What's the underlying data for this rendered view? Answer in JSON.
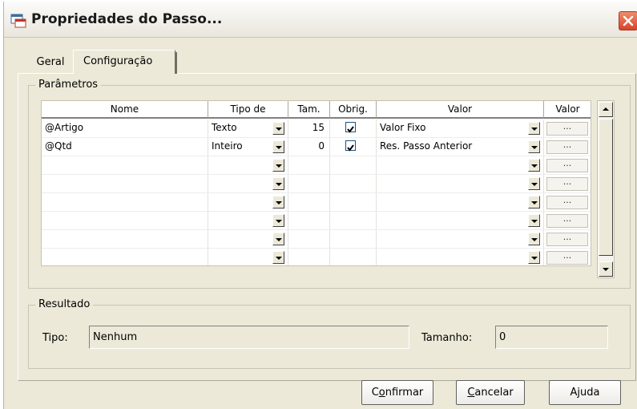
{
  "window": {
    "title": "Propriedades do Passo..."
  },
  "tabs": [
    {
      "label": "Geral",
      "active": false
    },
    {
      "label": "Configuração",
      "active": true
    }
  ],
  "parametros": {
    "legend": "Parâmetros",
    "columns": {
      "nome": "Nome",
      "tipo": "Tipo de",
      "tam": "Tam.",
      "obrig": "Obrig.",
      "valor": "Valor",
      "valor_btn": "Valor"
    },
    "rows": [
      {
        "nome": "@Artigo",
        "tipo": "Texto",
        "tam": "15",
        "obrig": true,
        "valor": "Valor Fixo",
        "btn": "..."
      },
      {
        "nome": "@Qtd",
        "tipo": "Inteiro",
        "tam": "0",
        "obrig": true,
        "valor": "Res. Passo Anterior",
        "btn": "..."
      },
      {
        "nome": "",
        "tipo": "",
        "tam": "",
        "obrig": false,
        "valor": "",
        "btn": "..."
      },
      {
        "nome": "",
        "tipo": "",
        "tam": "",
        "obrig": false,
        "valor": "",
        "btn": "..."
      },
      {
        "nome": "",
        "tipo": "",
        "tam": "",
        "obrig": false,
        "valor": "",
        "btn": "..."
      },
      {
        "nome": "",
        "tipo": "",
        "tam": "",
        "obrig": false,
        "valor": "",
        "btn": "..."
      },
      {
        "nome": "",
        "tipo": "",
        "tam": "",
        "obrig": false,
        "valor": "",
        "btn": "..."
      },
      {
        "nome": "",
        "tipo": "",
        "tam": "",
        "obrig": false,
        "valor": "",
        "btn": "..."
      }
    ]
  },
  "resultado": {
    "legend": "Resultado",
    "tipo_label": "Tipo:",
    "tipo_value": "Nenhum",
    "tamanho_label": "Tamanho:",
    "tamanho_value": "0"
  },
  "buttons": {
    "confirmar": {
      "pre": "C",
      "acc": "o",
      "post": "nfirmar"
    },
    "cancelar": {
      "pre": "",
      "acc": "C",
      "post": "ancelar"
    },
    "ajuda": "Ajuda"
  },
  "colors": {
    "dialog_bg": "#ece9d8",
    "close_red": "#d6452b",
    "checkbox_border": "#1c5180"
  },
  "icons": [
    "window-app-icon",
    "close-icon",
    "dropdown-arrow-icon",
    "scroll-up-icon",
    "scroll-down-icon",
    "check-icon"
  ]
}
